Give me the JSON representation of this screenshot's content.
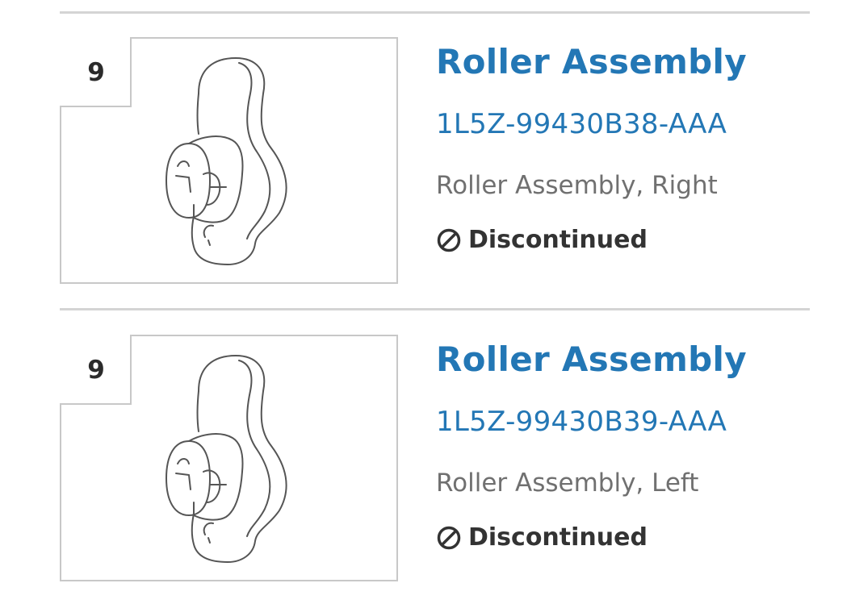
{
  "parts": [
    {
      "ref_number": "9",
      "title": "Roller Assembly",
      "part_number": "1L5Z-99430B38-AAA",
      "description": "Roller Assembly, Right",
      "status": "Discontinued",
      "image_icon": "roller-assembly-diagram"
    },
    {
      "ref_number": "9",
      "title": "Roller Assembly",
      "part_number": "1L5Z-99430B39-AAA",
      "description": "Roller Assembly, Left",
      "status": "Discontinued",
      "image_icon": "roller-assembly-diagram"
    }
  ],
  "colors": {
    "link": "#2377b5",
    "status_text": "#333333",
    "description_text": "#707070",
    "divider": "#d4d4d4"
  }
}
